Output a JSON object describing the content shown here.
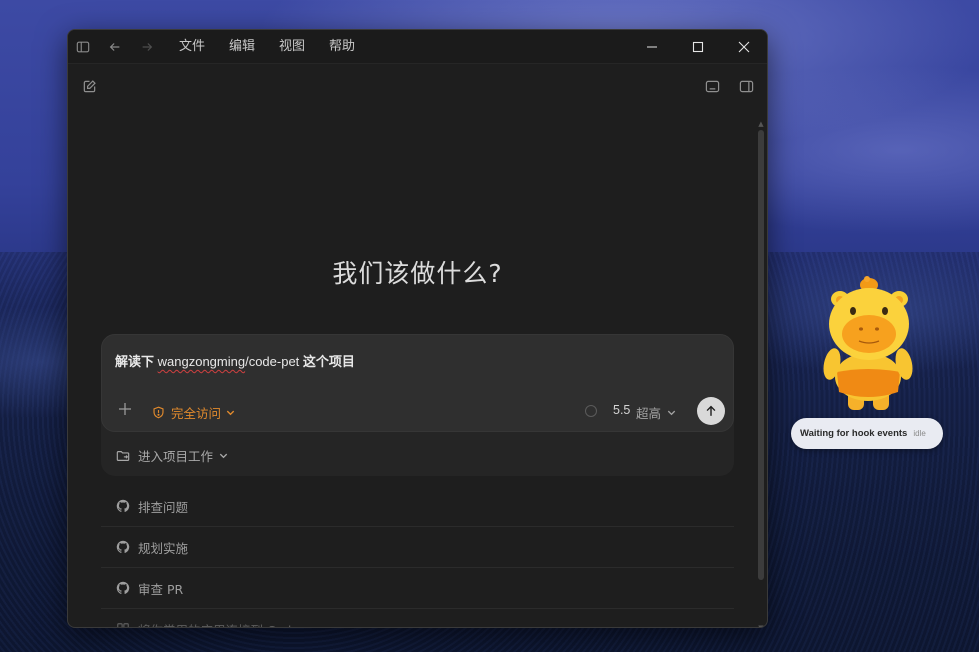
{
  "titlebar": {
    "menu": [
      "文件",
      "编辑",
      "视图",
      "帮助"
    ]
  },
  "main": {
    "heading": "我们该做什么?",
    "composer": {
      "prompt_bold_prefix": "解读下",
      "prompt_repo_user": "wangzongming",
      "prompt_repo_rest": "/code-pet",
      "prompt_bold_suffix": "这个项目",
      "access_label": "完全访问",
      "model": "5.5",
      "effort": "超高",
      "project_label": "进入项目工作"
    },
    "suggestions": [
      {
        "label": "排查问题",
        "icon": "github-icon"
      },
      {
        "label": "规划实施",
        "icon": "github-icon"
      },
      {
        "label": "审查 PR",
        "icon": "github-icon"
      },
      {
        "label": "将你常用的应用连接到 Codex",
        "icon": "apps-icon"
      }
    ]
  },
  "pet": {
    "status_message": "Waiting for hook events",
    "status_state": "idle"
  },
  "colors": {
    "accent_orange": "#e38b2d",
    "window_bg": "#1e1e1e",
    "composer_bg": "#2f2f2f"
  }
}
